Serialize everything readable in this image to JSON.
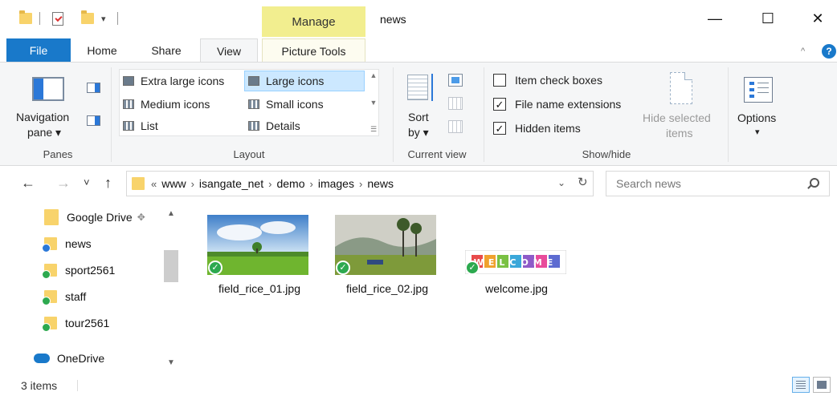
{
  "window": {
    "title": "news",
    "context_tab": "Manage",
    "controls": {
      "minimize": "—",
      "maximize": "☐",
      "close": "✕"
    },
    "qa_dropdown": "▾"
  },
  "ribbon_tabs": {
    "file": "File",
    "home": "Home",
    "share": "Share",
    "view": "View",
    "picture_tools": "Picture Tools",
    "collapse": "^",
    "help": "?"
  },
  "ribbon": {
    "panes": {
      "navigation_pane": "Navigation",
      "navigation_pane_line2": "pane ▾",
      "label": "Panes"
    },
    "layout": {
      "items": [
        "Extra large icons",
        "Large icons",
        "Medium icons",
        "Small icons",
        "List",
        "Details"
      ],
      "selected": "Large icons",
      "label": "Layout"
    },
    "current_view": {
      "sort": "Sort",
      "sort_line2": "by ▾",
      "label": "Current view"
    },
    "show_hide": {
      "checkboxes": [
        {
          "label": "Item check boxes",
          "checked": false
        },
        {
          "label": "File name extensions",
          "checked": true
        },
        {
          "label": "Hidden items",
          "checked": true
        }
      ],
      "hide_selected": "Hide selected",
      "hide_selected_line2": "items",
      "label": "Show/hide"
    },
    "options": {
      "label": "Options",
      "dropdown": "▾"
    }
  },
  "address": {
    "back": "←",
    "forward": "→",
    "recent": "˅",
    "up": "↑",
    "overflow": "«",
    "path": [
      "www",
      "isangate_net",
      "demo",
      "images",
      "news"
    ],
    "separator": "›",
    "dropdown": "⌄",
    "refresh": "↻"
  },
  "search": {
    "placeholder": "Search news"
  },
  "sidebar": {
    "items": [
      {
        "label": "Google Drive",
        "badge": "none",
        "pinned": true
      },
      {
        "label": "news",
        "badge": "sync-blue"
      },
      {
        "label": "sport2561",
        "badge": "ok-green"
      },
      {
        "label": "staff",
        "badge": "ok-green"
      },
      {
        "label": "tour2561",
        "badge": "ok-green"
      },
      {
        "label": "OneDrive",
        "badge": "cloud"
      }
    ],
    "pin_icon": "📌"
  },
  "files": [
    {
      "name": "field_rice_01.jpg",
      "status": "synced"
    },
    {
      "name": "field_rice_02.jpg",
      "status": "synced"
    },
    {
      "name": "welcome.jpg",
      "status": "synced",
      "thumb_text": "WELCOME"
    }
  ],
  "status_bar": {
    "count": "3 items"
  },
  "colors": {
    "accent": "#1979ca",
    "manage_tab": "#f2ee8f",
    "selected_layout": "#cce8ff",
    "sync_ok": "#2da94f",
    "folder": "#f8d36b"
  }
}
